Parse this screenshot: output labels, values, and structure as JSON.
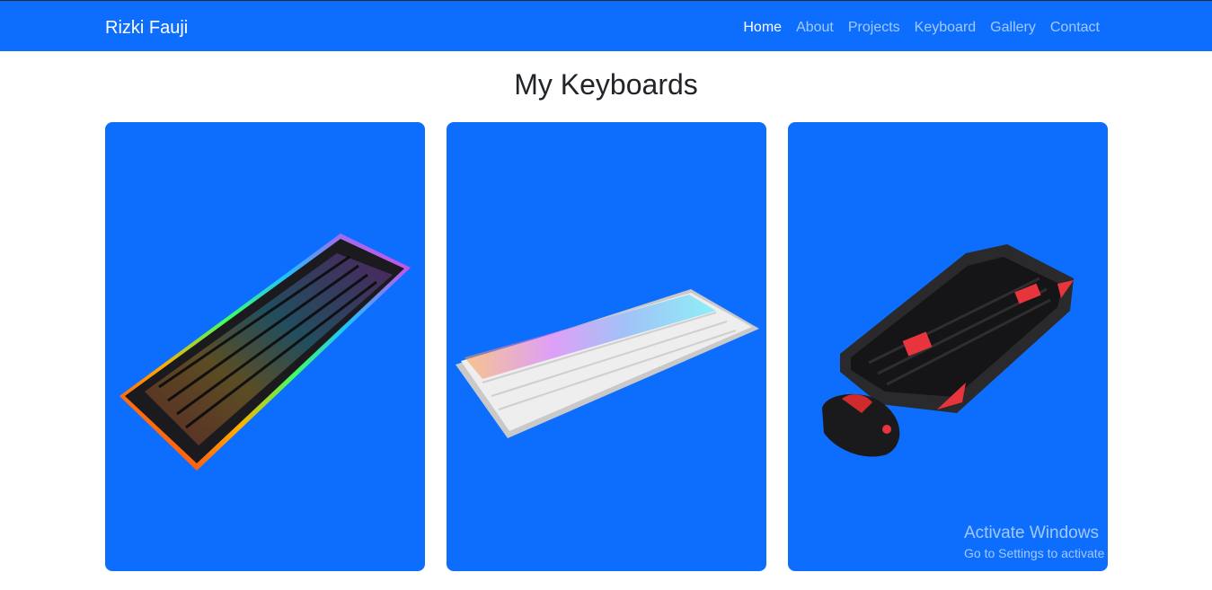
{
  "navbar": {
    "brand": "Rizki Fauji",
    "links": [
      {
        "label": "Home",
        "active": true
      },
      {
        "label": "About",
        "active": false
      },
      {
        "label": "Projects",
        "active": false
      },
      {
        "label": "Keyboard",
        "active": false
      },
      {
        "label": "Gallery",
        "active": false
      },
      {
        "label": "Contact",
        "active": false
      }
    ]
  },
  "main": {
    "title": "My Keyboards",
    "cards": [
      {
        "image": "rgb-slim-black-keyboard"
      },
      {
        "image": "white-rgb-mechanical-keyboard"
      },
      {
        "image": "gaming-keyboard-and-mouse-combo"
      }
    ]
  },
  "watermark": {
    "line1": "Activate Windows",
    "line2": "Go to Settings to activate Windows."
  },
  "colors": {
    "primary": "#0d6efd",
    "nav_text_active": "#ffffff",
    "nav_text": "#9ec5fe"
  }
}
